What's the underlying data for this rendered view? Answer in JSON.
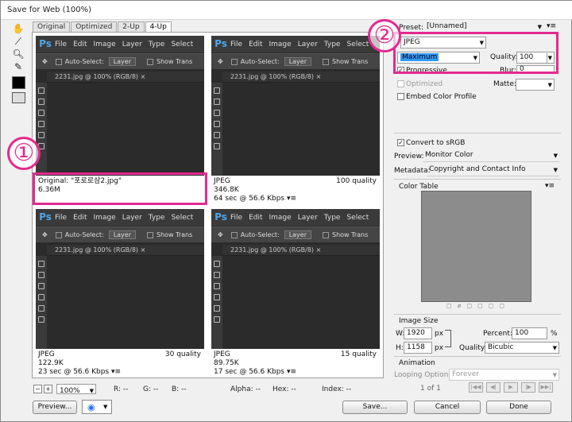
{
  "window": {
    "title": "Save for Web (100%)"
  },
  "tabs": [
    "Original",
    "Optimized",
    "2-Up",
    "4-Up"
  ],
  "ps": {
    "logo": "Ps",
    "menus": [
      "File",
      "Edit",
      "Image",
      "Layer",
      "Type",
      "Select"
    ],
    "auto_select": "Auto-Select:",
    "layer": "Layer",
    "show_trans": "Show Trans",
    "doc_tab": "2231.jpg @ 100% (RGB/8)",
    "close": "×"
  },
  "panes": [
    {
      "l1": "Original: \"포로로삼2.jpg\"",
      "l2": "6.36M",
      "l3": "",
      "right": ""
    },
    {
      "l1": "JPEG",
      "l2": "346.8K",
      "l3": "64 sec @ 56.6 Kbps ▾≡",
      "right": "100 quality"
    },
    {
      "l1": "JPEG",
      "l2": "122.9K",
      "l3": "23 sec @ 56.6 Kbps ▾≡",
      "right": "30 quality"
    },
    {
      "l1": "JPEG",
      "l2": "89.75K",
      "l3": "17 sec @ 56.6 Kbps ▾≡",
      "right": "15 quality"
    }
  ],
  "badges": {
    "one": "①",
    "two": "②"
  },
  "status": {
    "zoom": "100%",
    "r": "R: --",
    "g": "G: --",
    "b": "B: --",
    "alpha": "Alpha: --",
    "hex": "Hex: --",
    "index": "Index: --"
  },
  "settings": {
    "preset_label": "Preset:",
    "preset": "[Unnamed]",
    "format": "JPEG",
    "compression": "Maximum",
    "quality_label": "Quality:",
    "quality": "100",
    "progressive": "Progressive",
    "blur_label": "Blur:",
    "blur": "0",
    "optimized": "Optimized",
    "matte_label": "Matte:",
    "embed": "Embed Color Profile",
    "convert": "Convert to sRGB",
    "preview_label": "Preview:",
    "preview": "Monitor Color",
    "metadata_label": "Metadata:",
    "metadata": "Copyright and Contact Info",
    "color_table": "Color Table",
    "image_size": "Image Size",
    "w_label": "W:",
    "w": "1920",
    "h_label": "H:",
    "h": "1158",
    "px": "px",
    "percent_label": "Percent:",
    "percent": "100",
    "pct": "%",
    "quality2_label": "Quality:",
    "quality2": "Bicubic",
    "animation": "Animation",
    "looping_label": "Looping Options:",
    "looping": "Forever",
    "frame": "1 of 1"
  },
  "buttons": {
    "preview": "Preview...",
    "save": "Save...",
    "cancel": "Cancel",
    "done": "Done"
  }
}
